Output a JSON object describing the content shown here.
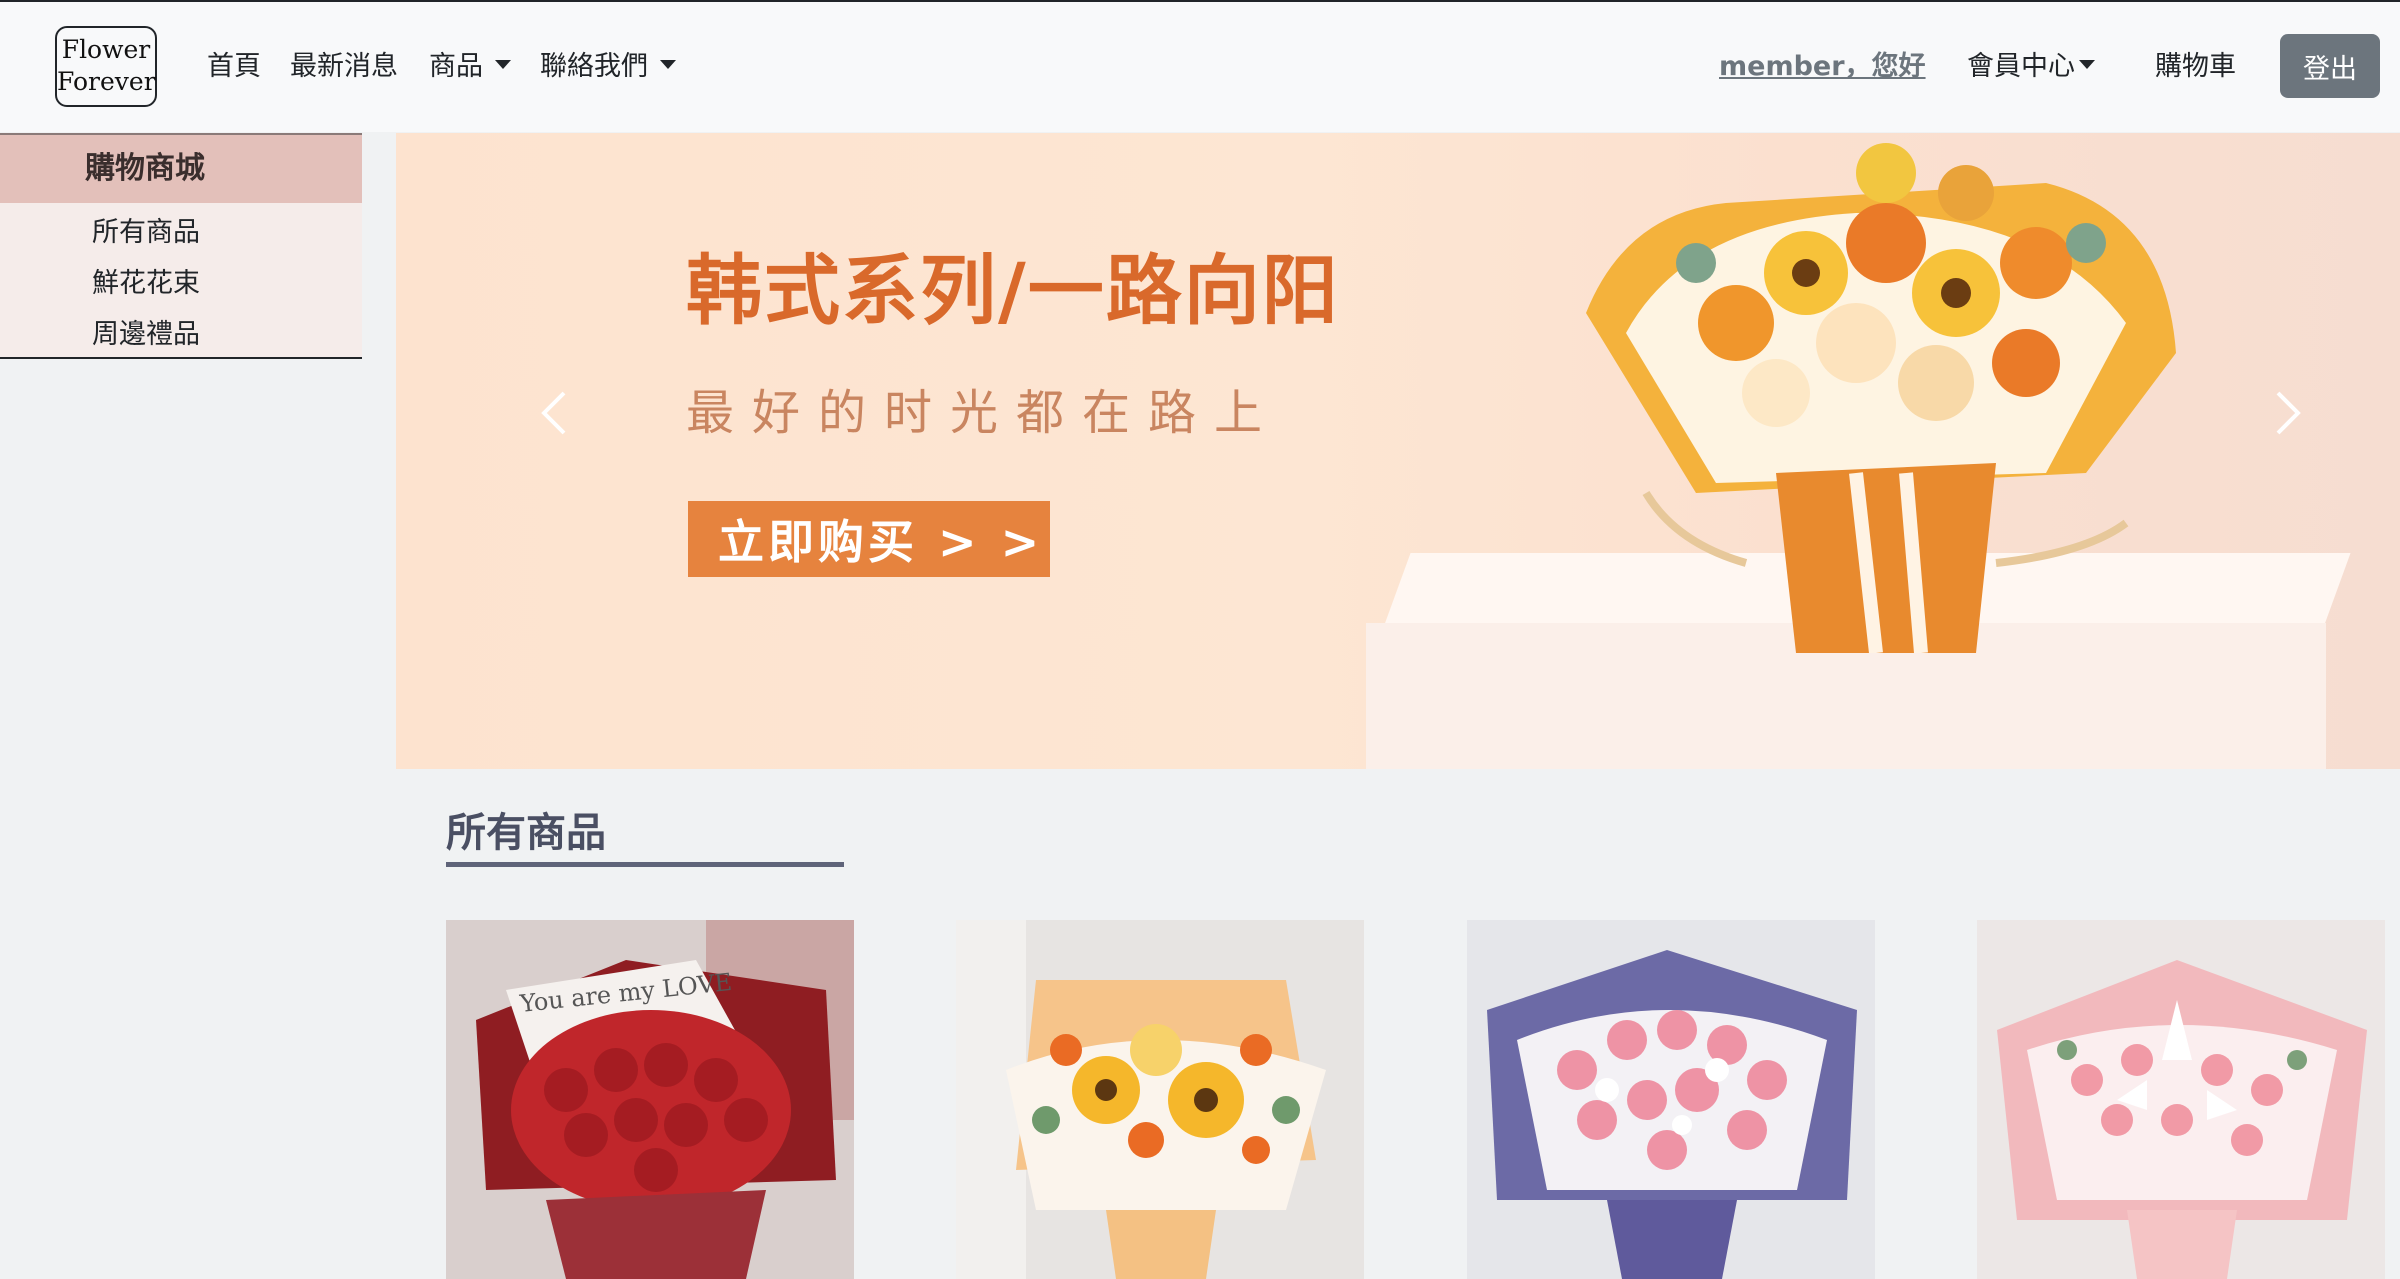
{
  "navbar": {
    "brand_line1": "Flower",
    "brand_line2": "Forever",
    "links": {
      "home": "首頁",
      "news": "最新消息",
      "products": "商品",
      "contact": "聯絡我們"
    },
    "member_greeting": "member，您好",
    "member_center": "會員中心",
    "cart": "購物車",
    "logout": "登出"
  },
  "sidebar": {
    "title": "購物商城",
    "items": [
      {
        "label": "所有商品"
      },
      {
        "label": "鮮花花束"
      },
      {
        "label": "周邊禮品"
      }
    ]
  },
  "carousel": {
    "title": "韩式系列/一路向阳",
    "subtitle": "最好的时光都在路上",
    "cta": "立即购买 > >"
  },
  "section": {
    "title": "所有商品"
  },
  "products": [
    {
      "name": "red-rose-bouquet",
      "card_text": "You are my LOVE",
      "color": "#b3262e"
    },
    {
      "name": "sunflower-bouquet",
      "color": "#f2b13b"
    },
    {
      "name": "pink-rose-purple-bouquet",
      "color": "#e8899a"
    },
    {
      "name": "pink-lily-bouquet",
      "color": "#f3a9b0"
    }
  ],
  "colors": {
    "navbar_bg": "#f8f9fa",
    "sidebar_head_bg": "#e3c0ba",
    "cta_orange": "#e6833e",
    "logout_bg": "#6c757d",
    "section_title": "#4a4f63"
  }
}
